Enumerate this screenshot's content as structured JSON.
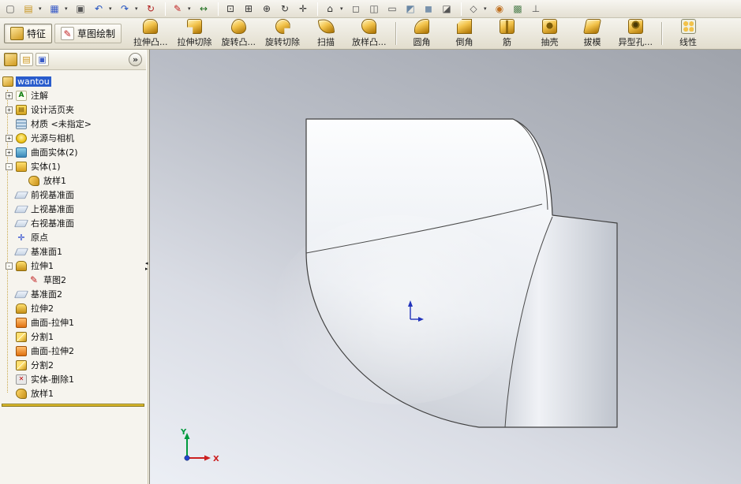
{
  "colors": {
    "selection": "#2a5ccc",
    "gold": "#f2c24a",
    "rollback": "#e8c830",
    "triad_x": "#cc2020",
    "triad_y": "#009a3e",
    "triad_z": "#2244cc"
  },
  "top_toolbar": {
    "items": [
      {
        "name": "new-icon",
        "glyph": "▢",
        "color": "#555"
      },
      {
        "name": "open-icon",
        "glyph": "▤",
        "color": "#c8941e",
        "dd": true
      },
      {
        "name": "save-icon",
        "glyph": "▦",
        "color": "#3a5cc8",
        "dd": true
      },
      {
        "name": "print-icon",
        "glyph": "▣",
        "color": "#555"
      },
      {
        "name": "undo-icon",
        "glyph": "↶",
        "color": "#2050c0",
        "dd": true
      },
      {
        "name": "redo-icon",
        "glyph": "↷",
        "color": "#2050c0",
        "dd": true
      },
      {
        "name": "rebuild-icon",
        "glyph": "↻",
        "color": "#b02020"
      },
      {
        "sep": true
      },
      {
        "name": "sketch-icon",
        "glyph": "✎",
        "color": "#c02020",
        "dd": true
      },
      {
        "name": "smart-dimension-icon",
        "glyph": "↔",
        "color": "#207020"
      },
      {
        "sep": true
      },
      {
        "name": "zoom-fit-icon",
        "glyph": "⊡",
        "color": "#333"
      },
      {
        "name": "zoom-area-icon",
        "glyph": "⊞",
        "color": "#333"
      },
      {
        "name": "zoom-in-out-icon",
        "glyph": "⊕",
        "color": "#333"
      },
      {
        "name": "rotate-view-icon",
        "glyph": "↻",
        "color": "#333"
      },
      {
        "name": "pan-icon",
        "glyph": "✛",
        "color": "#333"
      },
      {
        "sep": true
      },
      {
        "name": "standard-views-icon",
        "glyph": "⌂",
        "color": "#333",
        "dd": true
      },
      {
        "name": "wireframe-icon",
        "glyph": "◻",
        "color": "#555"
      },
      {
        "name": "hidden-lines-visible-icon",
        "glyph": "◫",
        "color": "#555"
      },
      {
        "name": "hidden-lines-removed-icon",
        "glyph": "▭",
        "color": "#555"
      },
      {
        "name": "shaded-with-edges-icon",
        "glyph": "◩",
        "color": "#6a87a5"
      },
      {
        "name": "shaded-icon",
        "glyph": "◼",
        "color": "#7a93ad"
      },
      {
        "name": "section-view-icon",
        "glyph": "◪",
        "color": "#555"
      },
      {
        "sep": true
      },
      {
        "name": "view-orientation-icon",
        "glyph": "◇",
        "color": "#555",
        "dd": true
      },
      {
        "name": "appearance-icon",
        "glyph": "◉",
        "color": "#c07020"
      },
      {
        "name": "scene-icon",
        "glyph": "▩",
        "color": "#508050"
      },
      {
        "name": "annotation-visibility-icon",
        "glyph": "⊥",
        "color": "#555"
      }
    ]
  },
  "features_toolbar": {
    "tabs": [
      {
        "id": "features",
        "label": "特征",
        "icon": "features-tab-icon",
        "iconClass": "i-part",
        "glyph": "",
        "pressed": true
      },
      {
        "id": "sketch",
        "label": "草图绘制",
        "icon": "sketch-tab-icon",
        "iconClass": "i-sketchpen",
        "glyph": "✎",
        "pressed": false
      }
    ],
    "buttons": [
      {
        "label": "拉伸凸...",
        "name": "extruded-boss-button",
        "icon": "extruded-boss-icon",
        "iconClass": "gold i-extrude"
      },
      {
        "label": "拉伸切除",
        "name": "extruded-cut-button",
        "icon": "extruded-cut-icon",
        "iconClass": "gold i-extrudecut"
      },
      {
        "label": "旋转凸...",
        "name": "revolved-boss-button",
        "icon": "revolved-boss-icon",
        "iconClass": "gold i-revolve"
      },
      {
        "label": "旋转切除",
        "name": "revolved-cut-button",
        "icon": "revolved-cut-icon",
        "iconClass": "gold i-revolvecut"
      },
      {
        "label": "扫描",
        "name": "sweep-button",
        "icon": "sweep-icon",
        "iconClass": "gold i-sweep"
      },
      {
        "label": "放样凸...",
        "name": "loft-button",
        "icon": "loft-icon",
        "iconClass": "gold i-loft"
      },
      {
        "sep": true
      },
      {
        "label": "圆角",
        "name": "fillet-button",
        "icon": "fillet-icon",
        "iconClass": "gold i-fillet"
      },
      {
        "label": "倒角",
        "name": "chamfer-button",
        "icon": "chamfer-icon",
        "iconClass": "gold i-chamfer"
      },
      {
        "label": "筋",
        "name": "rib-button",
        "icon": "rib-icon",
        "iconClass": "gold i-rib"
      },
      {
        "label": "抽壳",
        "name": "shell-button",
        "icon": "shell-icon",
        "iconClass": "gold i-shell"
      },
      {
        "label": "拔模",
        "name": "draft-button",
        "icon": "draft-icon",
        "iconClass": "gold i-draft"
      },
      {
        "label": "异型孔...",
        "name": "hole-wizard-button",
        "icon": "hole-wizard-icon",
        "iconClass": "gold i-hole"
      },
      {
        "sep": true
      },
      {
        "label": "线性",
        "name": "linear-pattern-button",
        "icon": "linear-pattern-icon",
        "iconClass": "i-linear icon20"
      }
    ]
  },
  "left_panel": {
    "header": {
      "tabs": [
        {
          "name": "featuremanager-tab-icon",
          "cls": "ph-fm",
          "glyph": ""
        },
        {
          "name": "propertymanager-tab-icon",
          "cls": "ph-pm",
          "glyph": "▤"
        },
        {
          "name": "configurationmanager-tab-icon",
          "cls": "ph-cm",
          "glyph": "▣"
        }
      ],
      "collapse_glyph": "»"
    },
    "tree": {
      "items": [
        {
          "label": "wantou",
          "icon": "part-icon",
          "cls": "ti-part",
          "indent": 0,
          "selected": true
        },
        {
          "label": "注解",
          "icon": "annotations-icon",
          "cls": "ti-annot",
          "glyph": "A",
          "indent": 1,
          "expand": "+"
        },
        {
          "label": "设计活页夹",
          "icon": "design-binder-icon",
          "cls": "ti-binder",
          "glyph": "▤",
          "indent": 1,
          "expand": "+"
        },
        {
          "label": "材质 <未指定>",
          "icon": "material-icon",
          "cls": "ti-material",
          "indent": 1
        },
        {
          "label": "光源与相机",
          "icon": "lights-cameras-icon",
          "cls": "ti-lights",
          "indent": 1,
          "expand": "+"
        },
        {
          "label": "曲面实体(2)",
          "icon": "surface-bodies-folder-icon",
          "cls": "ti-folder-surf",
          "indent": 1,
          "expand": "+"
        },
        {
          "label": "实体(1)",
          "icon": "solid-bodies-folder-icon",
          "cls": "ti-folder-solid",
          "indent": 1,
          "expand": "-"
        },
        {
          "label": "放样1",
          "icon": "loft-body-icon",
          "cls": "ti-loft",
          "indent": 2
        },
        {
          "label": "前视基准面",
          "icon": "front-plane-icon",
          "cls": "ti-plane",
          "indent": 1
        },
        {
          "label": "上视基准面",
          "icon": "top-plane-icon",
          "cls": "ti-plane",
          "indent": 1
        },
        {
          "label": "右视基准面",
          "icon": "right-plane-icon",
          "cls": "ti-plane",
          "indent": 1
        },
        {
          "label": "原点",
          "icon": "origin-icon",
          "cls": "ti-origin",
          "glyph": "✛",
          "indent": 1
        },
        {
          "label": "基准面1",
          "icon": "plane1-icon",
          "cls": "ti-plane",
          "indent": 1
        },
        {
          "label": "拉伸1",
          "icon": "extrude1-icon",
          "cls": "ti-extrude",
          "indent": 1,
          "expand": "-"
        },
        {
          "label": "草图2",
          "icon": "sketch2-icon",
          "cls": "ti-sketch",
          "glyph": "✎",
          "indent": 2
        },
        {
          "label": "基准面2",
          "icon": "plane2-icon",
          "cls": "ti-plane",
          "indent": 1
        },
        {
          "label": "拉伸2",
          "icon": "extrude2-icon",
          "cls": "ti-extrude",
          "indent": 1
        },
        {
          "label": "曲面-拉伸1",
          "icon": "surface-extrude1-icon",
          "cls": "ti-surfext",
          "indent": 1
        },
        {
          "label": "分割1",
          "icon": "split1-icon",
          "cls": "ti-split",
          "indent": 1
        },
        {
          "label": "曲面-拉伸2",
          "icon": "surface-extrude2-icon",
          "cls": "ti-surfext",
          "indent": 1
        },
        {
          "label": "分割2",
          "icon": "split2-icon",
          "cls": "ti-split",
          "indent": 1
        },
        {
          "label": "实体-删除1",
          "icon": "body-delete1-icon",
          "cls": "ti-delete",
          "glyph": "✕",
          "indent": 1
        },
        {
          "label": "放样1",
          "icon": "loft1-feature-icon",
          "cls": "ti-loft",
          "indent": 1
        }
      ]
    }
  },
  "viewport": {
    "triad": {
      "x_label": "X",
      "y_label": "Y"
    }
  }
}
